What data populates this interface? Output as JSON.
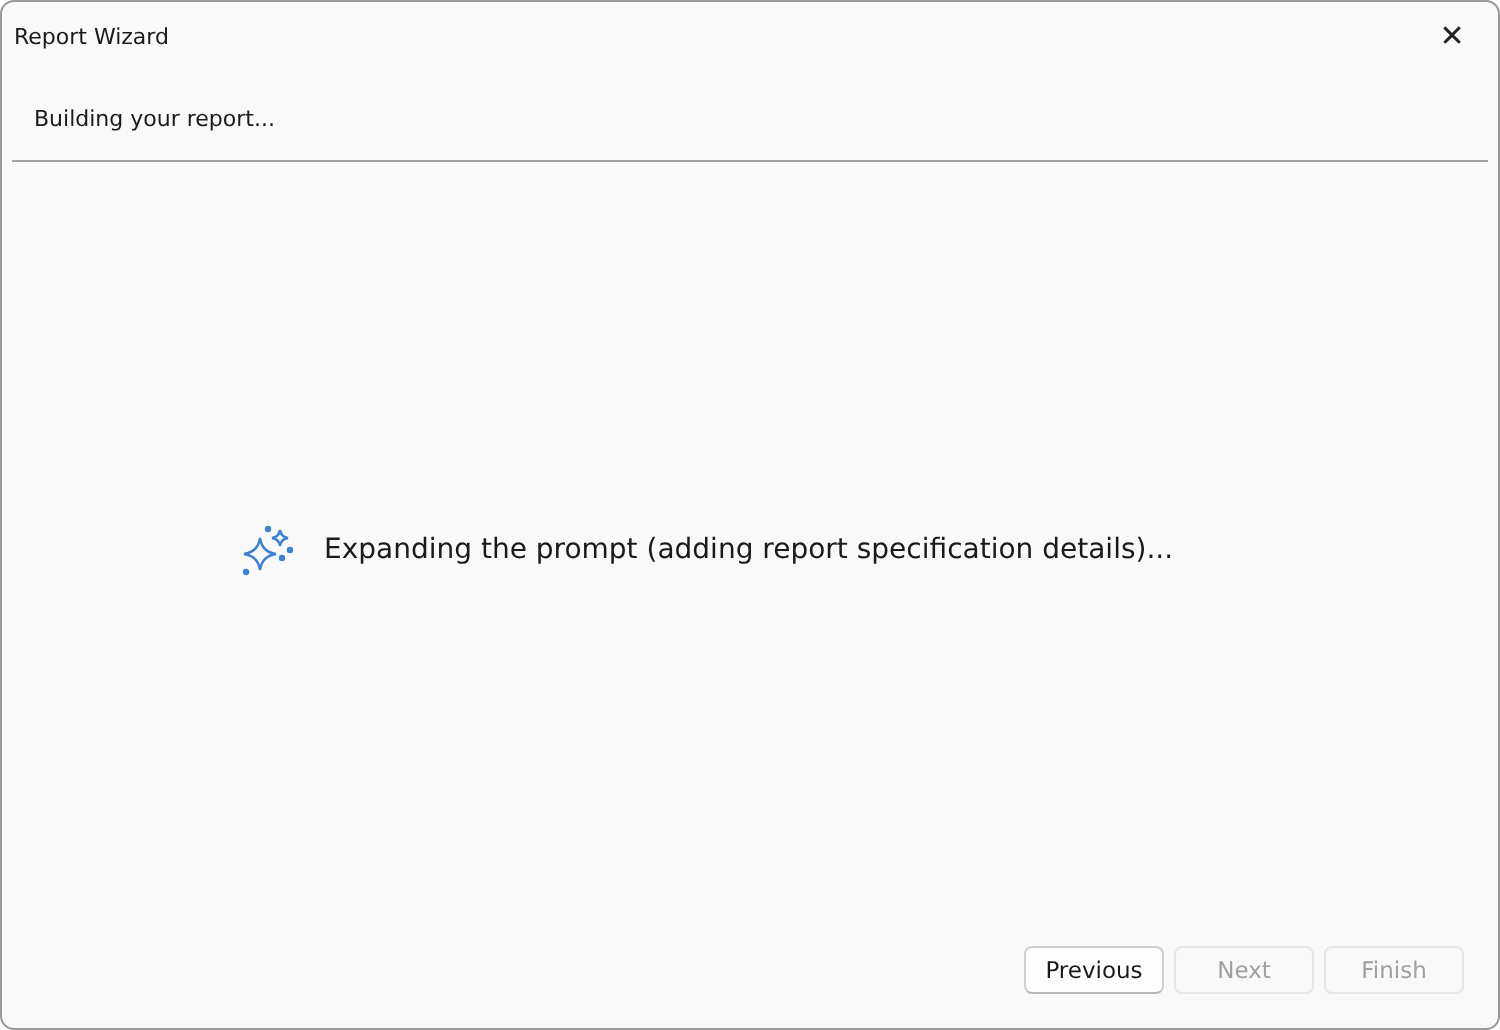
{
  "window": {
    "title": "Report Wizard",
    "close": "✕"
  },
  "header": {
    "text": "Building your report..."
  },
  "status": {
    "text": "Expanding the prompt (adding report specification details)..."
  },
  "buttons": [
    {
      "label": "Previous",
      "disabled": false
    },
    {
      "label": "Next",
      "disabled": true
    },
    {
      "label": "Finish",
      "disabled": true
    }
  ]
}
